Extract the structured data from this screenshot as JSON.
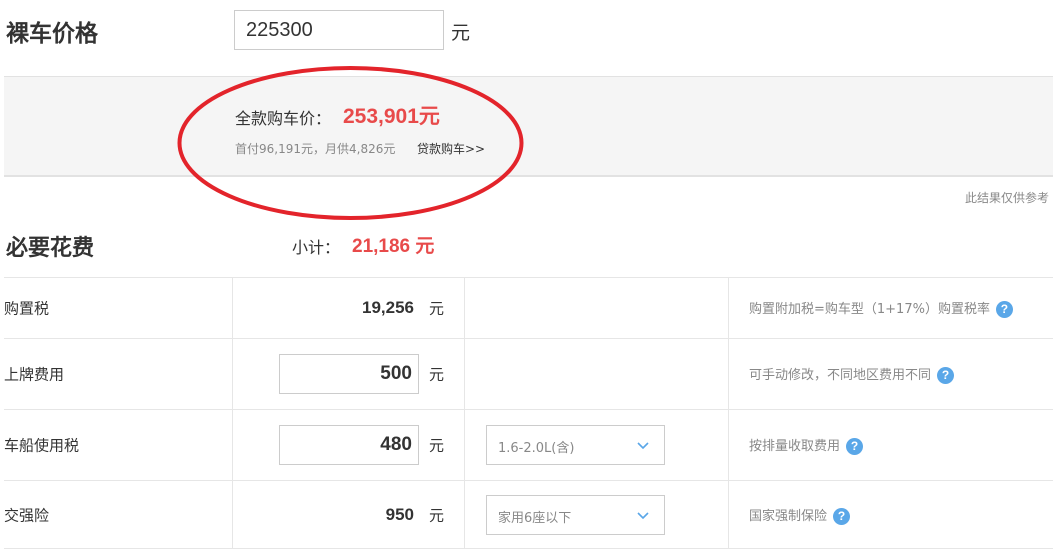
{
  "price": {
    "title": "裸车价格",
    "input_value": "225300",
    "unit": "元"
  },
  "summary": {
    "full_label": "全款购车价：",
    "full_value": "253,901元",
    "loan_line": "首付96,191元，月供4,826元",
    "loan_link": "贷款购车>>"
  },
  "disclaimer": "此结果仅供参考",
  "required": {
    "title": "必要花费",
    "subtotal_label": "小计：",
    "subtotal_value": "21,186 元"
  },
  "fees": [
    {
      "label": "购置税",
      "value": "19,256",
      "editable": false,
      "unit": "元",
      "note": "购置附加税=购车型（1+17%）购置税率"
    },
    {
      "label": "上牌费用",
      "value": "500",
      "editable": true,
      "unit": "元",
      "note": "可手动修改，不同地区费用不同"
    },
    {
      "label": "车船使用税",
      "value": "480",
      "editable": true,
      "unit": "元",
      "select": "1.6-2.0L(含)",
      "note": "按排量收取费用"
    },
    {
      "label": "交强险",
      "value": "950",
      "editable": false,
      "unit": "元",
      "select": "家用6座以下",
      "note": "国家强制保险"
    }
  ],
  "colors": {
    "accent": "#e84a4a",
    "help": "#5aa7e8",
    "annotation": "#e3242b"
  },
  "icons": {
    "help": "question-circle-icon",
    "dropdown": "chevron-down-icon"
  }
}
